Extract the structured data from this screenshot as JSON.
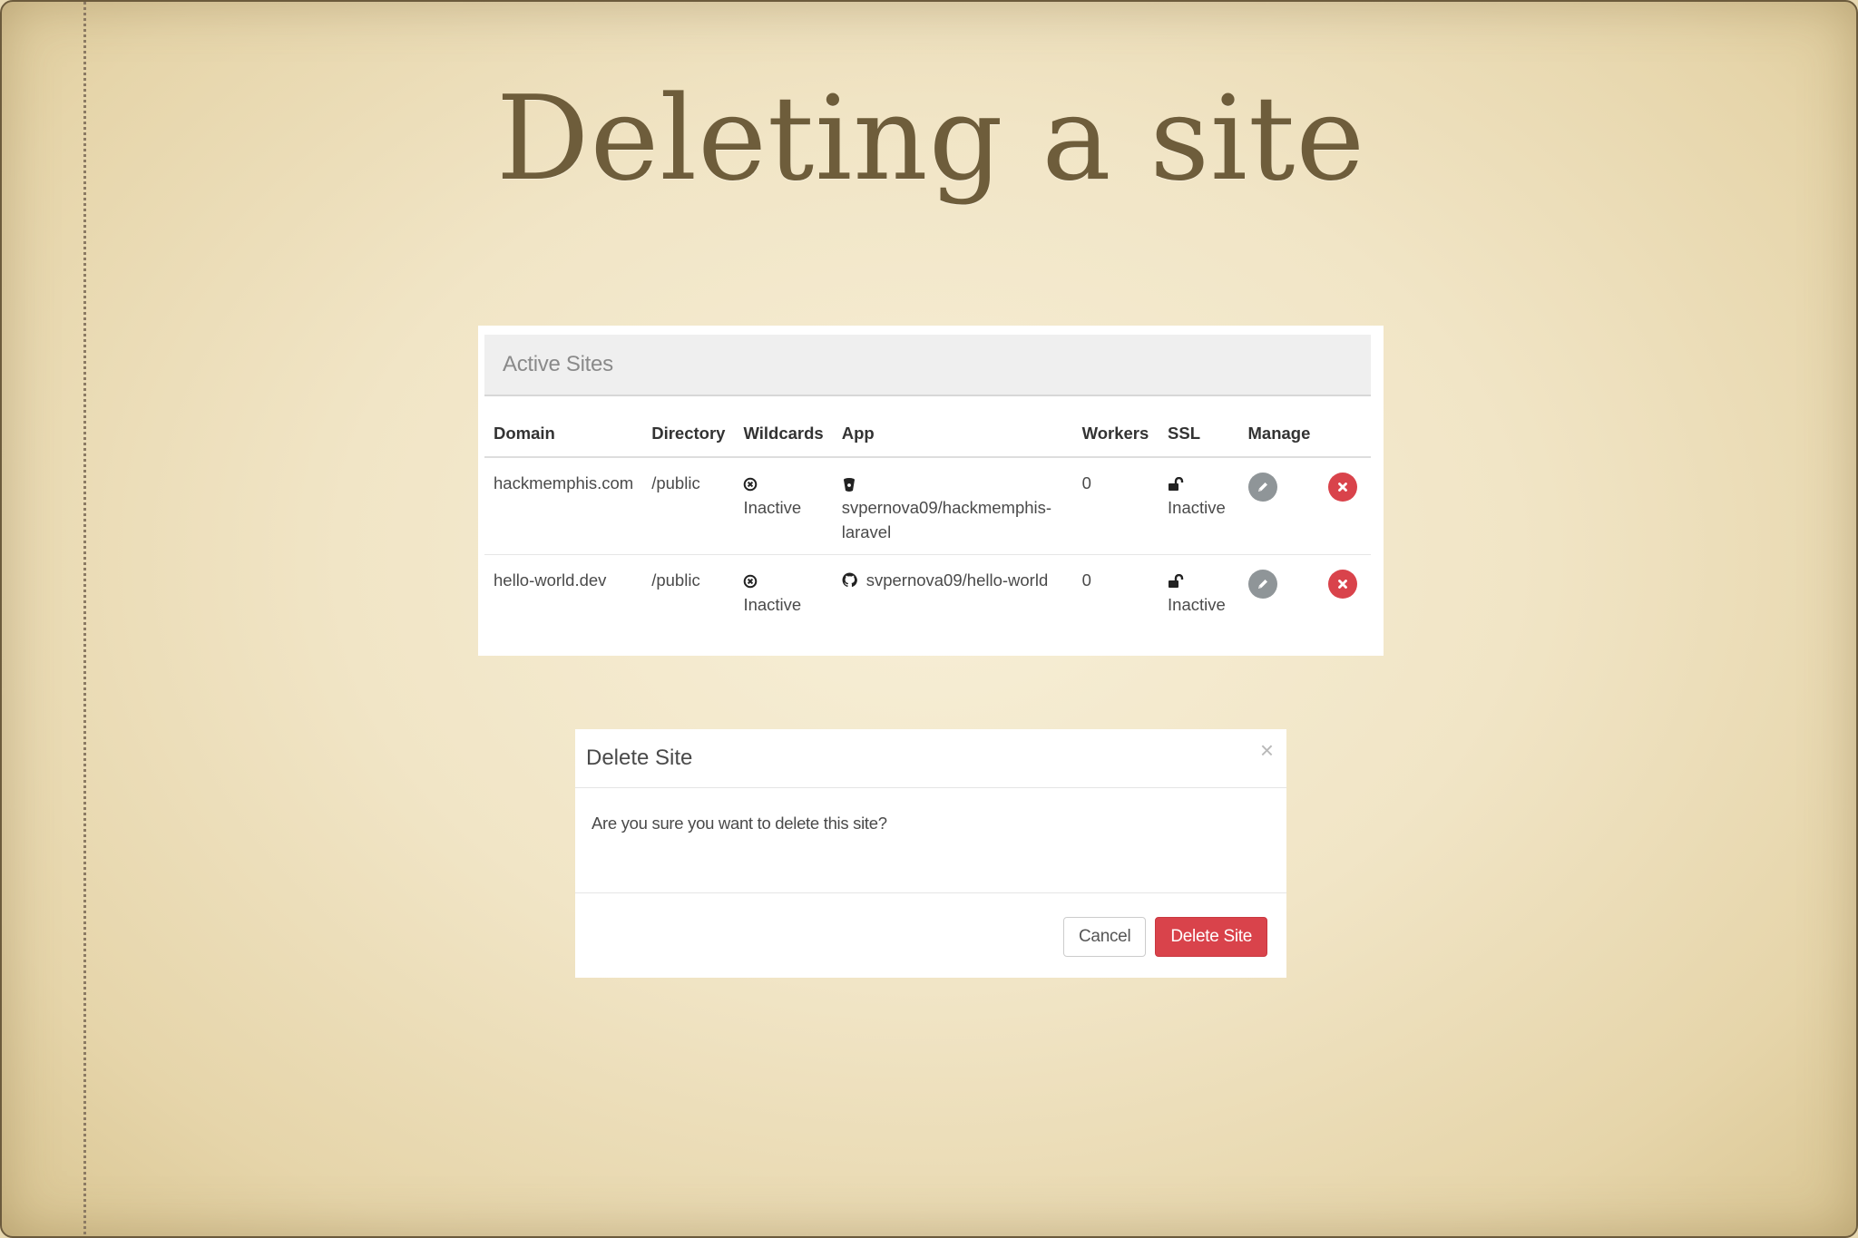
{
  "slide": {
    "title": "Deleting a site"
  },
  "panel": {
    "heading": "Active Sites",
    "columns": {
      "domain": "Domain",
      "directory": "Directory",
      "wildcards": "Wildcards",
      "app": "App",
      "workers": "Workers",
      "ssl": "SSL",
      "manage": "Manage"
    },
    "rows": [
      {
        "domain": "hackmemphis.com",
        "directory": "/public",
        "wildcards_status": "Inactive",
        "wildcards_icon": "times-circle-icon",
        "app_icon": "bitbucket-icon",
        "app_repo": "svpernova09/hackmemphis-laravel",
        "workers": "0",
        "ssl_icon": "unlock-icon",
        "ssl_status": "Inactive",
        "manage_icon": "pencil-icon",
        "delete_icon": "times-icon"
      },
      {
        "domain": "hello-world.dev",
        "directory": "/public",
        "wildcards_status": "Inactive",
        "wildcards_icon": "times-circle-icon",
        "app_icon": "github-icon",
        "app_repo": "svpernova09/hello-world",
        "workers": "0",
        "ssl_icon": "unlock-icon",
        "ssl_status": "Inactive",
        "manage_icon": "pencil-icon",
        "delete_icon": "times-icon"
      }
    ]
  },
  "modal": {
    "title": "Delete Site",
    "close_glyph": "×",
    "message": "Are you sure you want to delete this site?",
    "cancel_label": "Cancel",
    "confirm_label": "Delete Site"
  },
  "colors": {
    "danger": "#d9434b",
    "edit_button": "#8f9598",
    "title_text": "#6e5d3b",
    "slide_background": "#f1e5c6"
  }
}
